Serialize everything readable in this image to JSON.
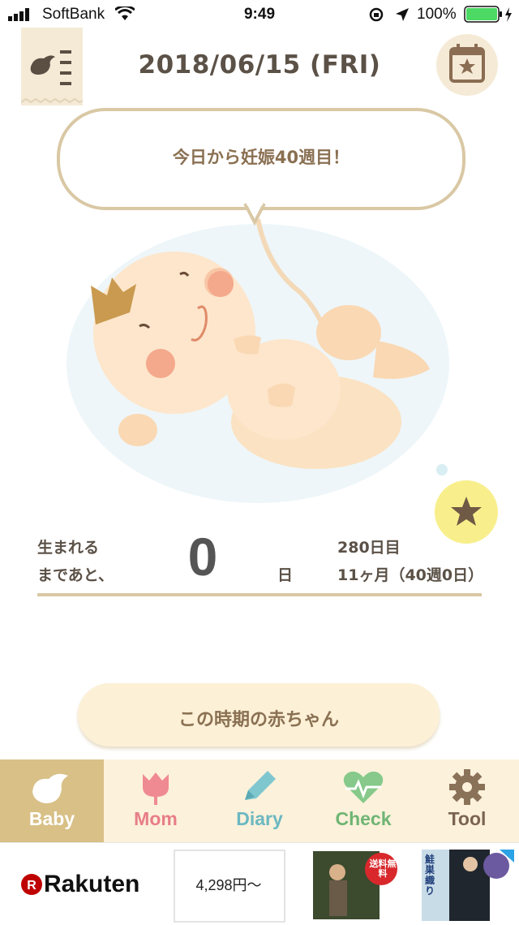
{
  "status": {
    "carrier": "SoftBank",
    "time": "9:49",
    "battery": "100%"
  },
  "header": {
    "date": "2018/06/15 (FRI)"
  },
  "bubble": {
    "text": "今日から妊娠40週目！"
  },
  "countdown": {
    "line1": "生まれる",
    "line2": "まであと、",
    "days": "0",
    "unit": "日",
    "day_index": "280日目",
    "month_week": "11ヶ月（40週0日）"
  },
  "period_button": {
    "label": "この時期の赤ちゃん"
  },
  "tabs": [
    {
      "label": "Baby",
      "icon": "bird-icon",
      "color": "#ffffff",
      "active": true
    },
    {
      "label": "Mom",
      "icon": "tulip-icon",
      "color": "#ef8a93",
      "active": false
    },
    {
      "label": "Diary",
      "icon": "pencil-icon",
      "color": "#7fc7cf",
      "active": false
    },
    {
      "label": "Check",
      "icon": "heart-pulse-icon",
      "color": "#86c98a",
      "active": false
    },
    {
      "label": "Tool",
      "icon": "gear-icon",
      "color": "#8a7258",
      "active": false
    }
  ],
  "ad": {
    "brand": "Rakuten",
    "price": "4,298円～",
    "badge": "送料無料",
    "product_title": "鮭巣織り"
  },
  "colors": {
    "accent": "#d9c8a4",
    "active_tab": "#d8c087",
    "tab_bar": "#fcf1db",
    "battery": "#4cd964"
  }
}
